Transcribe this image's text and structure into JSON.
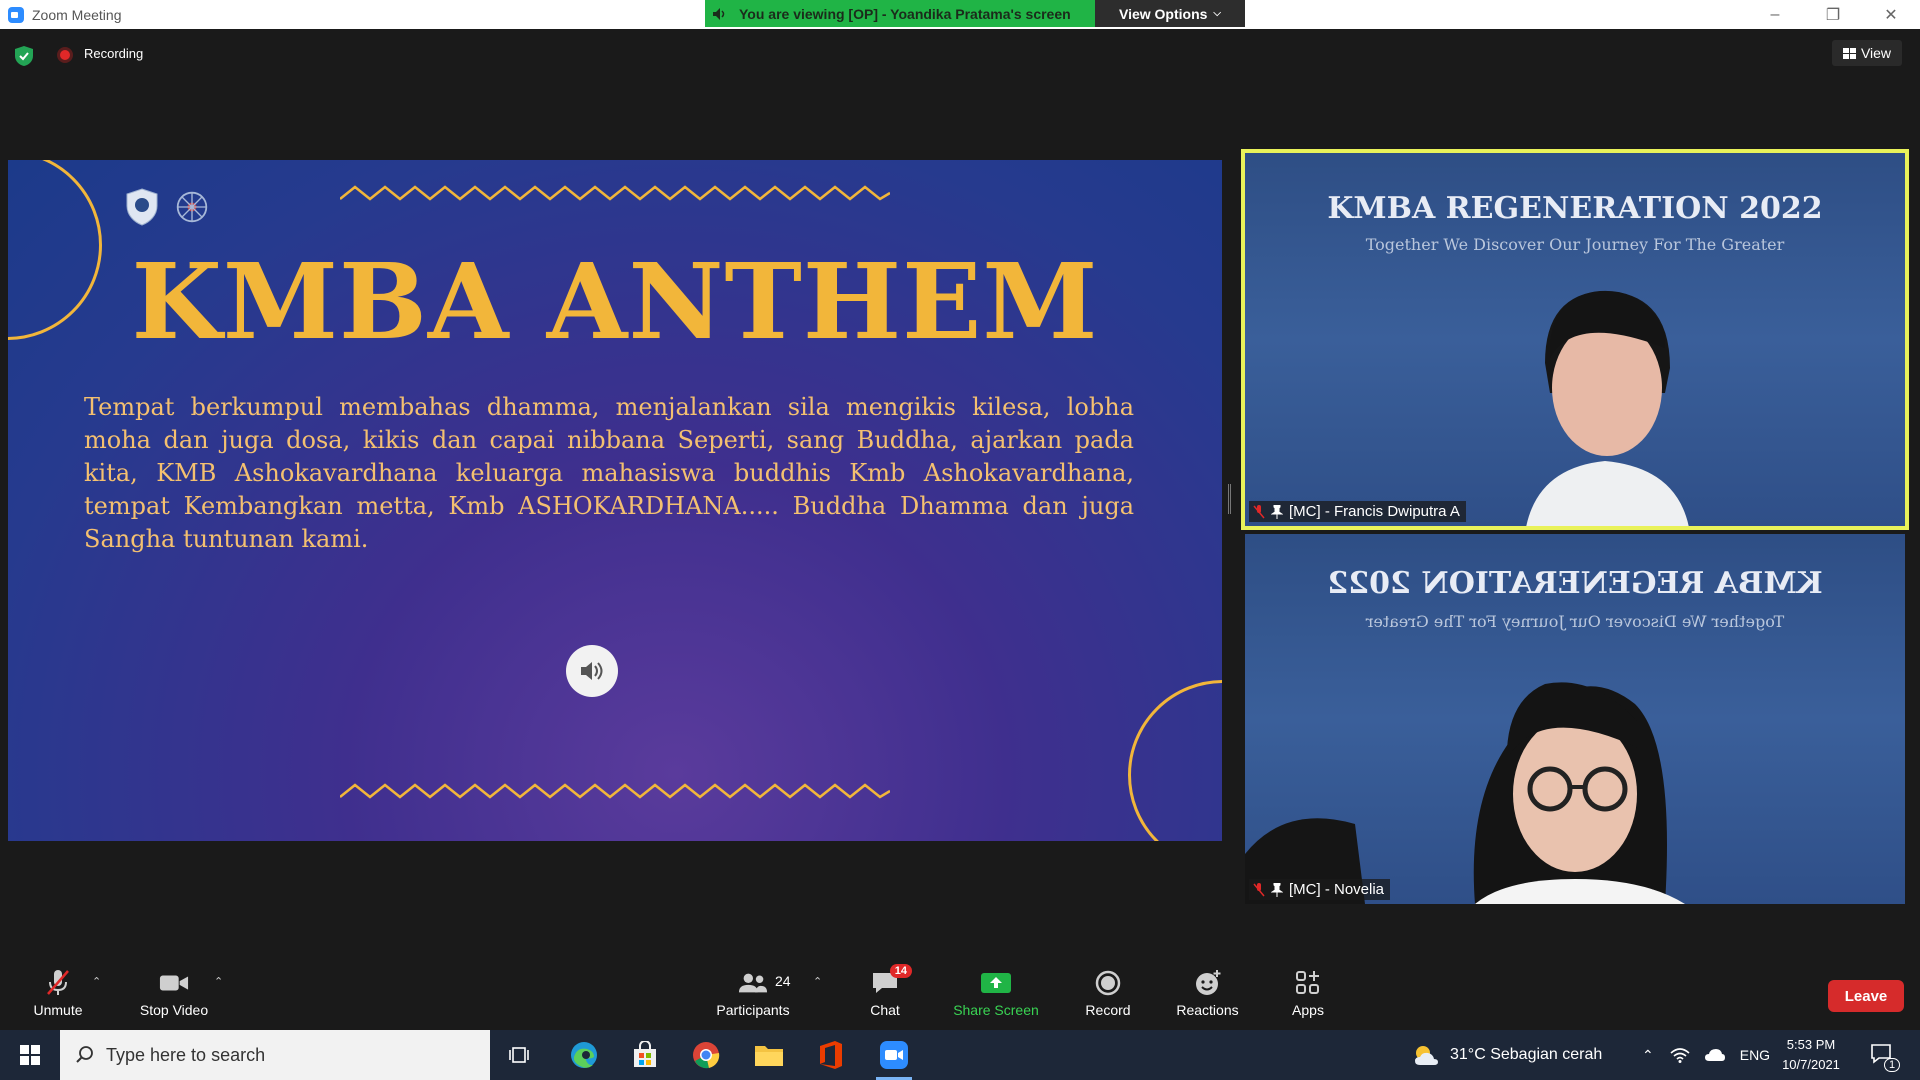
{
  "window": {
    "title": "Zoom Meeting"
  },
  "banner": {
    "viewing": "You are viewing [OP] - Yoandika Pratama's screen",
    "view_options": "View Options"
  },
  "top": {
    "recording": "Recording",
    "view": "View"
  },
  "slide": {
    "title": "KMBA ANTHEM",
    "lyrics": "Tempat berkumpul membahas dhamma, menjalankan sila mengikis kilesa, lobha moha dan juga dosa, kikis dan capai nibbana Seperti, sang Buddha, ajarkan pada kita, KMB Ashokavardhana keluarga mahasiswa buddhis Kmb Ashokavardhana, tempat Kembangkan metta, Kmb ASHOKARDHANA.....  Buddha Dhamma dan juga Sangha tuntunan kami."
  },
  "tiles": [
    {
      "name": "[MC] - Francis Dwiputra A",
      "heading": "KMBA REGENERATION 2022",
      "sub": "Together We Discover Our Journey For The Greater",
      "active": true
    },
    {
      "name": "[MC] - Novelia",
      "heading": "KMBA REGENERATION 2022",
      "sub": "Together We Discover Our Journey For The Greater",
      "active": false
    }
  ],
  "toolbar": {
    "unmute": "Unmute",
    "stop_video": "Stop Video",
    "participants": "Participants",
    "participants_count": "24",
    "chat": "Chat",
    "chat_badge": "14",
    "share_screen": "Share Screen",
    "record": "Record",
    "reactions": "Reactions",
    "apps": "Apps",
    "leave": "Leave"
  },
  "taskbar": {
    "search_placeholder": "Type here to search",
    "weather": "31°C  Sebagian cerah",
    "lang": "ENG",
    "time": "5:53 PM",
    "date": "10/7/2021",
    "notif_count": "1"
  },
  "colors": {
    "accent_gold": "#f2b63a",
    "banner_green": "#20b446",
    "leave_red": "#d62b2b",
    "active_outline": "#e9f25a"
  }
}
